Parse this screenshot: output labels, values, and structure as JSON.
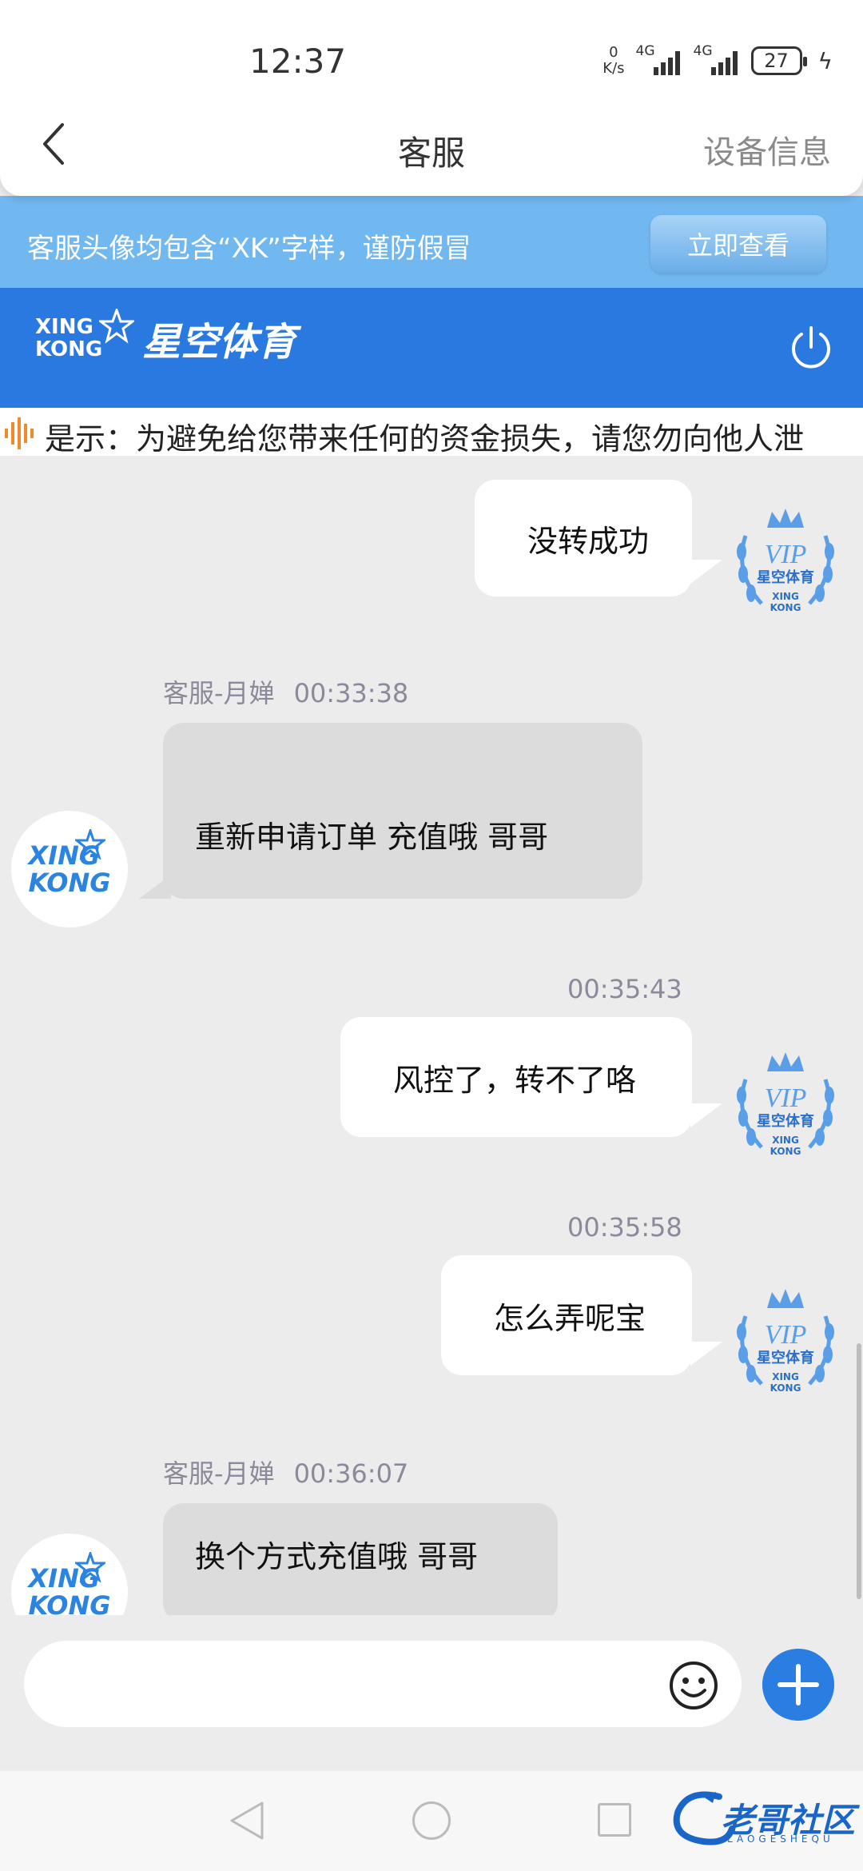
{
  "status_bar": {
    "time": "12:37",
    "net_speed_value": "0",
    "net_speed_unit": "K/s",
    "signal1_label": "4G",
    "signal2_label": "4G",
    "battery": "27"
  },
  "header": {
    "title": "客服",
    "right_action": "设备信息"
  },
  "notice": {
    "text": "客服头像均包含“XK”字样，谨防假冒",
    "button_label": "立即查看"
  },
  "brand": {
    "logo_en_line1": "XING",
    "logo_en_line2": "KONG",
    "logo_cn": "星空体育"
  },
  "marquee": {
    "text": "是示：为避免给您带来任何的资金损失，请您勿向他人泄"
  },
  "messages": [
    {
      "side": "out",
      "text": "没转成功",
      "time": ""
    },
    {
      "side": "in",
      "agent": "客服-月婵",
      "time": "00:33:38",
      "text": "重新申请订单 充值哦 哥哥"
    },
    {
      "side": "out",
      "time": "00:35:43",
      "text": "风控了，转不了咯"
    },
    {
      "side": "out",
      "time": "00:35:58",
      "text": "怎么弄呢宝"
    },
    {
      "side": "in",
      "agent": "客服-月婵",
      "time": "00:36:07",
      "text": "换个方式充值哦 哥哥"
    }
  ],
  "avatars": {
    "vip_label": "VIP",
    "vip_cn": "星空体育",
    "vip_en1": "XING",
    "vip_en2": "KONG",
    "cs_line1": "XING",
    "cs_line2": "KONG"
  },
  "input": {
    "placeholder": ""
  },
  "watermark": {
    "text": "老哥社区",
    "sub": "LAOGESHEQU"
  },
  "colors": {
    "accent": "#2a7de1",
    "brand_bar": "#2979e0",
    "notice_bar": "#71b7f0",
    "chat_bg": "#ececec",
    "incoming_bubble": "#dcdcdc",
    "outgoing_bubble": "#ffffff"
  }
}
